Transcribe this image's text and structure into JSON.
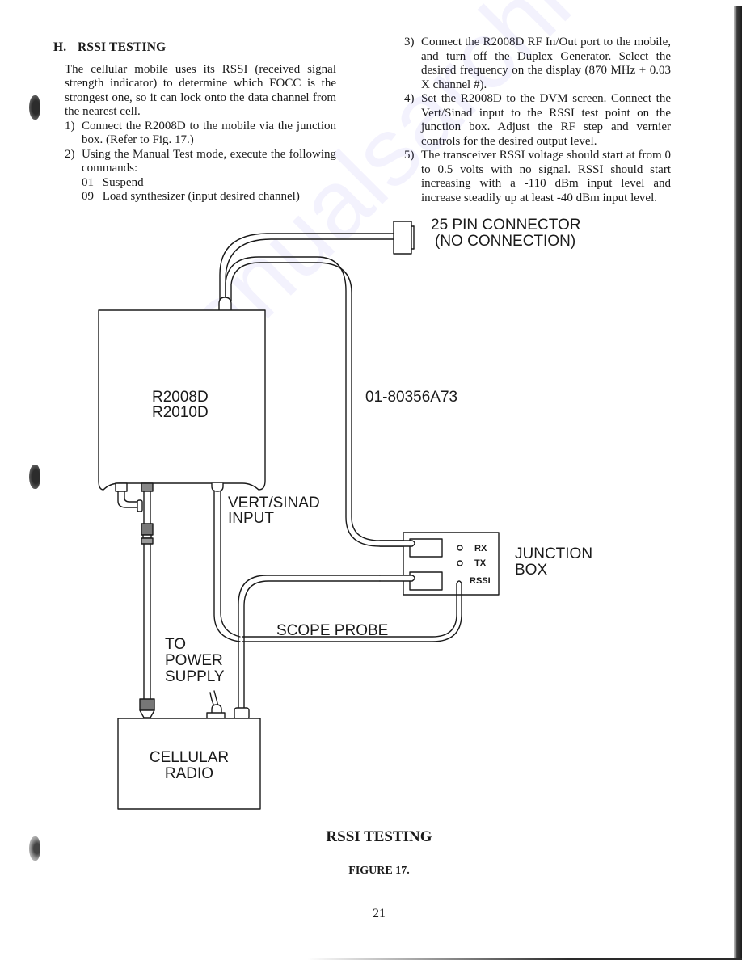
{
  "section": {
    "letter": "H.",
    "title": "RSSI TESTING",
    "intro": "The cellular mobile uses its RSSI (received signal strength indicator) to determine which FOCC is the strongest one, so it can lock onto the data channel from the nearest cell."
  },
  "steps": [
    {
      "num": "1)",
      "text": "Connect the R2008D to the mobile via the junction box. (Refer to Fig. 17.)"
    },
    {
      "num": "2)",
      "text": "Using the Manual Test mode, execute the following commands:",
      "commands": [
        {
          "code": "01",
          "label": "Suspend"
        },
        {
          "code": "09",
          "label": "Load synthesizer (input desired channel)"
        }
      ]
    },
    {
      "num": "3)",
      "text": "Connect the R2008D RF In/Out port to the mobile, and turn off the Duplex Generator. Select the desired frequency on the display (870 MHz + 0.03 X channel #)."
    },
    {
      "num": "4)",
      "text": "Set the R2008D to the DVM screen. Connect the Vert/Sinad input to the RSSI test point on the junction box. Adjust the RF step and vernier controls for the desired output level."
    },
    {
      "num": "5)",
      "text": "The transceiver RSSI voltage should start at from 0 to 0.5 volts with no signal. RSSI should start increasing with a -110 dBm input level and increase steadily up at least -40 dBm input level."
    }
  ],
  "diagram": {
    "connector_label_1": "25 PIN CONNECTOR",
    "connector_label_2": "(NO CONNECTION)",
    "analyzer_label_1": "R2008D",
    "analyzer_label_2": "R2010D",
    "cable_label": "01-80356A73",
    "vert_sinad_1": "VERT/SINAD",
    "vert_sinad_2": "INPUT",
    "junction_rx": "RX",
    "junction_tx": "TX",
    "junction_rssi": "RSSI",
    "junction_label_1": "JUNCTION",
    "junction_label_2": "BOX",
    "scope_probe": "SCOPE PROBE",
    "power_1": "TO",
    "power_2": "POWER",
    "power_3": "SUPPLY",
    "radio_label_1": "CELLULAR",
    "radio_label_2": "RADIO"
  },
  "watermark": "manualsarchive.com",
  "caption": {
    "title": "RSSI TESTING",
    "figure": "FIGURE 17."
  },
  "page_number": "21"
}
